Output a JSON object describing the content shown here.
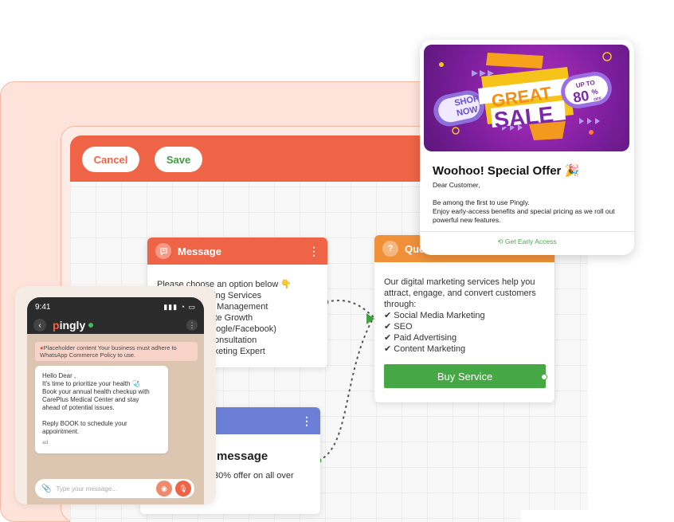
{
  "toolbar": {
    "cancel_label": "Cancel",
    "save_label": "Save"
  },
  "message_node": {
    "title": "Message",
    "lines": [
      "Please choose an option below 👇",
      "eting Services",
      "n Management",
      "ite Growth",
      "oogle/Facebook)",
      "onsultation",
      "rketing Expert"
    ]
  },
  "question_node": {
    "title": "Ques",
    "intro": "Our digital marketing services help you attract, engage, and convert customers through:",
    "items": [
      "✔ Social Media Marketing",
      "✔ SEO",
      "✔ Paid Advertising",
      "✔ Content Marketing"
    ],
    "button_label": "Buy Service"
  },
  "blue_node": {
    "title": "message",
    "text": "30% offer on all over"
  },
  "phone": {
    "time": "9:41",
    "brand_first": "p",
    "brand_rest": "ingly",
    "policy_text": "Placeholder content Your business must adhere to WhatsApp Commerce Policy to use.",
    "bubble_lines": [
      "Hello Dear ,",
      "It's time to prioritize your health 🩺",
      "Book your annual health checkup with",
      "CarePlus Medical Center and stay",
      "ahead of potential issues."
    ],
    "bubble_cta_1": "Reply BOOK to schedule your",
    "bubble_cta_2": "appointment.",
    "ad_label": "ad",
    "composer_placeholder": "Type your message..."
  },
  "offer": {
    "banner": {
      "shop": "SHOP",
      "now": "NOW",
      "great": "GREAT",
      "sale": "SALE",
      "up_to": "UP TO",
      "percent": "80",
      "pct_sign": "%",
      "off": "OFF"
    },
    "title": "Woohoo! Special Offer 🎉",
    "greeting": "Dear Customer,",
    "line1": "Be among the first to use Pingly.",
    "line2": "Enjoy early-access benefits and special pricing as we roll out powerful new features.",
    "cta": "Get Early Access"
  },
  "colors": {
    "brand": "#ef6446",
    "accent_green": "#45a845",
    "question_header": "#f0913a",
    "blue_header": "#6b7fd6"
  }
}
